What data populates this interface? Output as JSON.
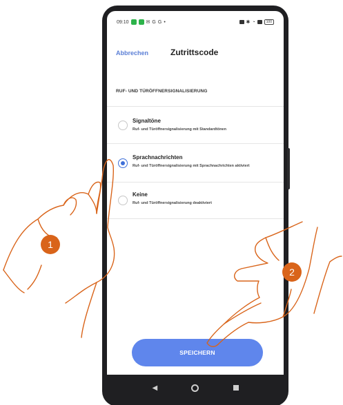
{
  "status_bar": {
    "time": "09:10",
    "left_icons": [
      "app-icon-green",
      "app-icon-green",
      "whatsapp-icon",
      "google-icon",
      "google-icon",
      "dot-icon"
    ],
    "battery_label": "100"
  },
  "header": {
    "cancel_label": "Abbrechen",
    "title": "Zutrittscode"
  },
  "section": {
    "title": "RUF- UND TÜRÖFFNERSIGNALISIERUNG"
  },
  "options": [
    {
      "label": "Signaltöne",
      "description": "Ruf- und Türöffnersignalisierung mit Standardtönen",
      "selected": false
    },
    {
      "label": "Sprachnachrichten",
      "description": "Ruf- und Türöffnersignalisierung mit Sprachnachrichten aktiviert",
      "selected": true
    },
    {
      "label": "Keine",
      "description": "Ruf- und Türöffnersignalisierung deaktiviert",
      "selected": false
    }
  ],
  "save_button": {
    "label": "SPEICHERN"
  },
  "nav": {
    "back": "◀",
    "home": "home",
    "recent": "recent"
  },
  "steps": {
    "step1": "1",
    "step2": "2"
  },
  "colors": {
    "accent": "#3e6fd8",
    "button": "#5f86ec",
    "link": "#5b7fd6",
    "badge": "#d9641a",
    "phone_frame": "#1f1f22"
  }
}
